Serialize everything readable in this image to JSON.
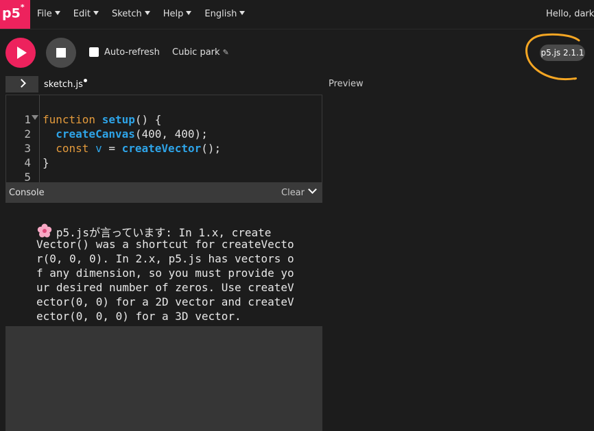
{
  "nav": {
    "logo": "p5",
    "logo_mark": "*",
    "menus": [
      "File",
      "Edit",
      "Sketch",
      "Help",
      "English"
    ],
    "user": "Hello, dark_"
  },
  "toolbar": {
    "auto_refresh_label": "Auto-refresh",
    "auto_refresh_checked": false,
    "sketch_name": "Cubic park",
    "version": "p5.js 2.1.1"
  },
  "editor": {
    "file_name": "sketch.js",
    "line_numbers": [
      "1",
      "2",
      "3",
      "4",
      "5"
    ]
  },
  "preview": {
    "label": "Preview"
  },
  "console": {
    "title": "Console",
    "clear_label": "Clear",
    "message_lines": [
      "   p5.jsが言っています: In 1.x, create",
      "Vector() was a shortcut for createVecto",
      "r(0, 0, 0). In 2.x, p5.js has vectors o",
      "f any dimension, so you must provide yo",
      "ur desired number of zeros. Use createV",
      "ector(0, 0) for a 2D vector and createV",
      "ector(0, 0, 0) for a 3D vector."
    ]
  },
  "colors": {
    "accent": "#ed225d",
    "annotation": "#f5a623",
    "keyword": "#e39a3c",
    "function": "#2ea4e8"
  }
}
